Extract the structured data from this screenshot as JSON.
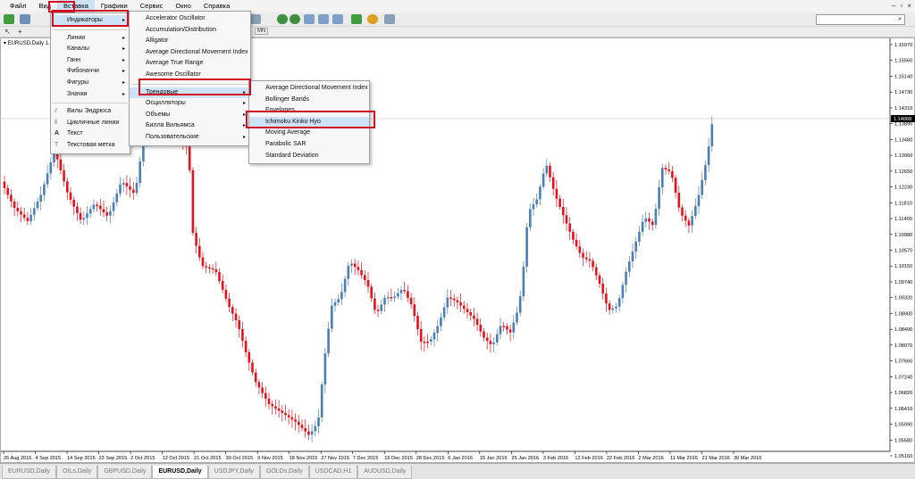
{
  "menubar": {
    "items": [
      {
        "label": "Файл"
      },
      {
        "label": "Вид"
      },
      {
        "label": "Вставка"
      },
      {
        "label": "Графики"
      },
      {
        "label": "Сервис"
      },
      {
        "label": "Окно"
      },
      {
        "label": "Справка"
      }
    ]
  },
  "chart": {
    "label": "EURUSD,Daily 1.13",
    "current_price": "1.14068",
    "price_labels": [
      "1.15970",
      "1.15560",
      "1.15140",
      "1.14730",
      "1.14310",
      "1.13890",
      "1.13480",
      "1.13060",
      "1.12650",
      "1.12230",
      "1.11810",
      "1.11400",
      "1.10980",
      "1.10570",
      "1.10150",
      "1.09740",
      "1.09320",
      "1.08900",
      "1.08490",
      "1.08070",
      "1.07660",
      "1.07240",
      "1.06820",
      "1.06410",
      "1.05990",
      "1.05580",
      "1.05160"
    ],
    "date_labels": [
      "26 Aug 2015",
      "4 Sep 2015",
      "14 Sep 2015",
      "23 Sep 2015",
      "2 Oct 2015",
      "12 Oct 2015",
      "21 Oct 2015",
      "30 Oct 2015",
      "9 Nov 2015",
      "18 Nov 2015",
      "27 Nov 2015",
      "7 Dec 2015",
      "16 Dec 2015",
      "28 Dec 2015",
      "6 Jan 2016",
      "15 Jan 2016",
      "25 Jan 2016",
      "3 Feb 2016",
      "12 Feb 2016",
      "22 Feb 2016",
      "2 Mar 2016",
      "11 Mar 2016",
      "21 Mar 2016",
      "30 Mar 2016"
    ],
    "up_color": "#4a7fb5",
    "down_color": "#e8101a"
  },
  "menu_insert": {
    "items": [
      {
        "label": "Индикаторы"
      },
      {
        "label": "Линии"
      },
      {
        "label": "Каналы"
      },
      {
        "label": "Ганн"
      },
      {
        "label": "Фибоначчи"
      },
      {
        "label": "Фигуры"
      },
      {
        "label": "Значки"
      },
      {
        "label": "Вилы Эндрюса"
      },
      {
        "label": "Цикличные линии"
      },
      {
        "label": "Текст"
      },
      {
        "label": "Текстовая метка"
      }
    ]
  },
  "menu_indicators": {
    "items": [
      {
        "label": "Accelerator Oscillator"
      },
      {
        "label": "Accumulation/Distribution"
      },
      {
        "label": "Alligator"
      },
      {
        "label": "Average Directional Movement Index"
      },
      {
        "label": "Average True Range"
      },
      {
        "label": "Awesome Oscillator"
      },
      {
        "label": "Трендовые"
      },
      {
        "label": "Осцилляторы"
      },
      {
        "label": "Объемы"
      },
      {
        "label": "Билла Вильямса"
      },
      {
        "label": "Пользовательские"
      }
    ]
  },
  "menu_trend": {
    "items": [
      {
        "label": "Average Directional Movement Index"
      },
      {
        "label": "Bollinger Bands"
      },
      {
        "label": "Envelopes"
      },
      {
        "label": "Ichimoku Kinko Hyo"
      },
      {
        "label": "Moving Average"
      },
      {
        "label": "Parabolic SAR"
      },
      {
        "label": "Standard Deviation"
      }
    ]
  },
  "toolbar": {
    "timeframe_mn": "MN"
  },
  "tabs": [
    {
      "label": "EURUSD,Daily"
    },
    {
      "label": "OILs,Daily"
    },
    {
      "label": "GBPUSD,Daily"
    },
    {
      "label": "EURUSD,Daily"
    },
    {
      "label": "USDJPY,Daily"
    },
    {
      "label": "GOLDs,Daily"
    },
    {
      "label": "USDCAD,H1"
    },
    {
      "label": "AUDUSD,Daily"
    }
  ],
  "colors": {
    "highlight_border": "#d01020",
    "menu_highlight": "#cde2f7"
  }
}
